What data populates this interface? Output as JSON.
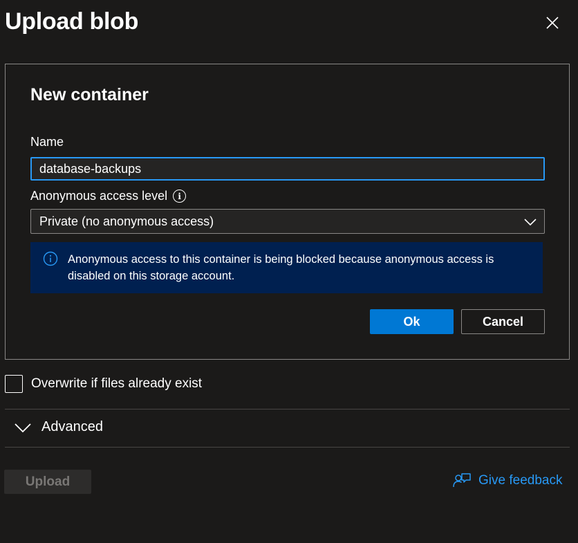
{
  "panel": {
    "title": "Upload blob"
  },
  "dialog": {
    "title": "New container",
    "name_label": "Name",
    "name_value": "database-backups",
    "access_label": "Anonymous access level",
    "access_selected": "Private (no anonymous access)",
    "banner_text": "Anonymous access to this container is being blocked because anonymous access is disabled on this storage account.",
    "ok_label": "Ok",
    "cancel_label": "Cancel"
  },
  "options": {
    "overwrite_label": "Overwrite if files already exist",
    "overwrite_checked": false,
    "advanced_label": "Advanced"
  },
  "footer": {
    "upload_label": "Upload",
    "feedback_label": "Give feedback"
  },
  "icons": {
    "close": "close-icon",
    "info": "info-icon",
    "chevron": "chevron-down-icon",
    "feedback": "feedback-icon"
  },
  "colors": {
    "background": "#1b1a19",
    "accent": "#0078d4",
    "link": "#2899f5",
    "banner": "#002050"
  }
}
